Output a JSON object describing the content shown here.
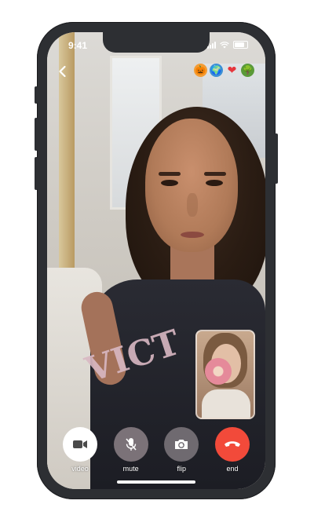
{
  "status_bar": {
    "time": "9:41"
  },
  "header": {
    "back_icon": "chevron-left-icon",
    "reactions": [
      {
        "name": "pumpkin",
        "glyph": "🎃",
        "bg": "#f39c33"
      },
      {
        "name": "globe",
        "glyph": "🌍",
        "bg": "#3b8fd6"
      },
      {
        "name": "heart",
        "glyph": "❤",
        "bg": "#e6363c"
      },
      {
        "name": "tree",
        "glyph": "🌳",
        "bg": "#5a9a3a"
      }
    ]
  },
  "call": {
    "pip_label": "self-view"
  },
  "controls": [
    {
      "id": "video",
      "label": "video",
      "icon": "video-camera-icon",
      "bg": "#ffffff",
      "icon_color": "#4a4a4a"
    },
    {
      "id": "mute",
      "label": "mute",
      "icon": "microphone-off-icon",
      "bg": "#7b7278",
      "icon_color": "#ffffff"
    },
    {
      "id": "flip",
      "label": "flip",
      "icon": "camera-flip-icon",
      "bg": "#6f6a70",
      "icon_color": "#ffffff"
    },
    {
      "id": "end",
      "label": "end",
      "icon": "phone-hangup-icon",
      "bg": "#f24a3a",
      "icon_color": "#ffffff"
    }
  ],
  "shirt_text": "VICT"
}
